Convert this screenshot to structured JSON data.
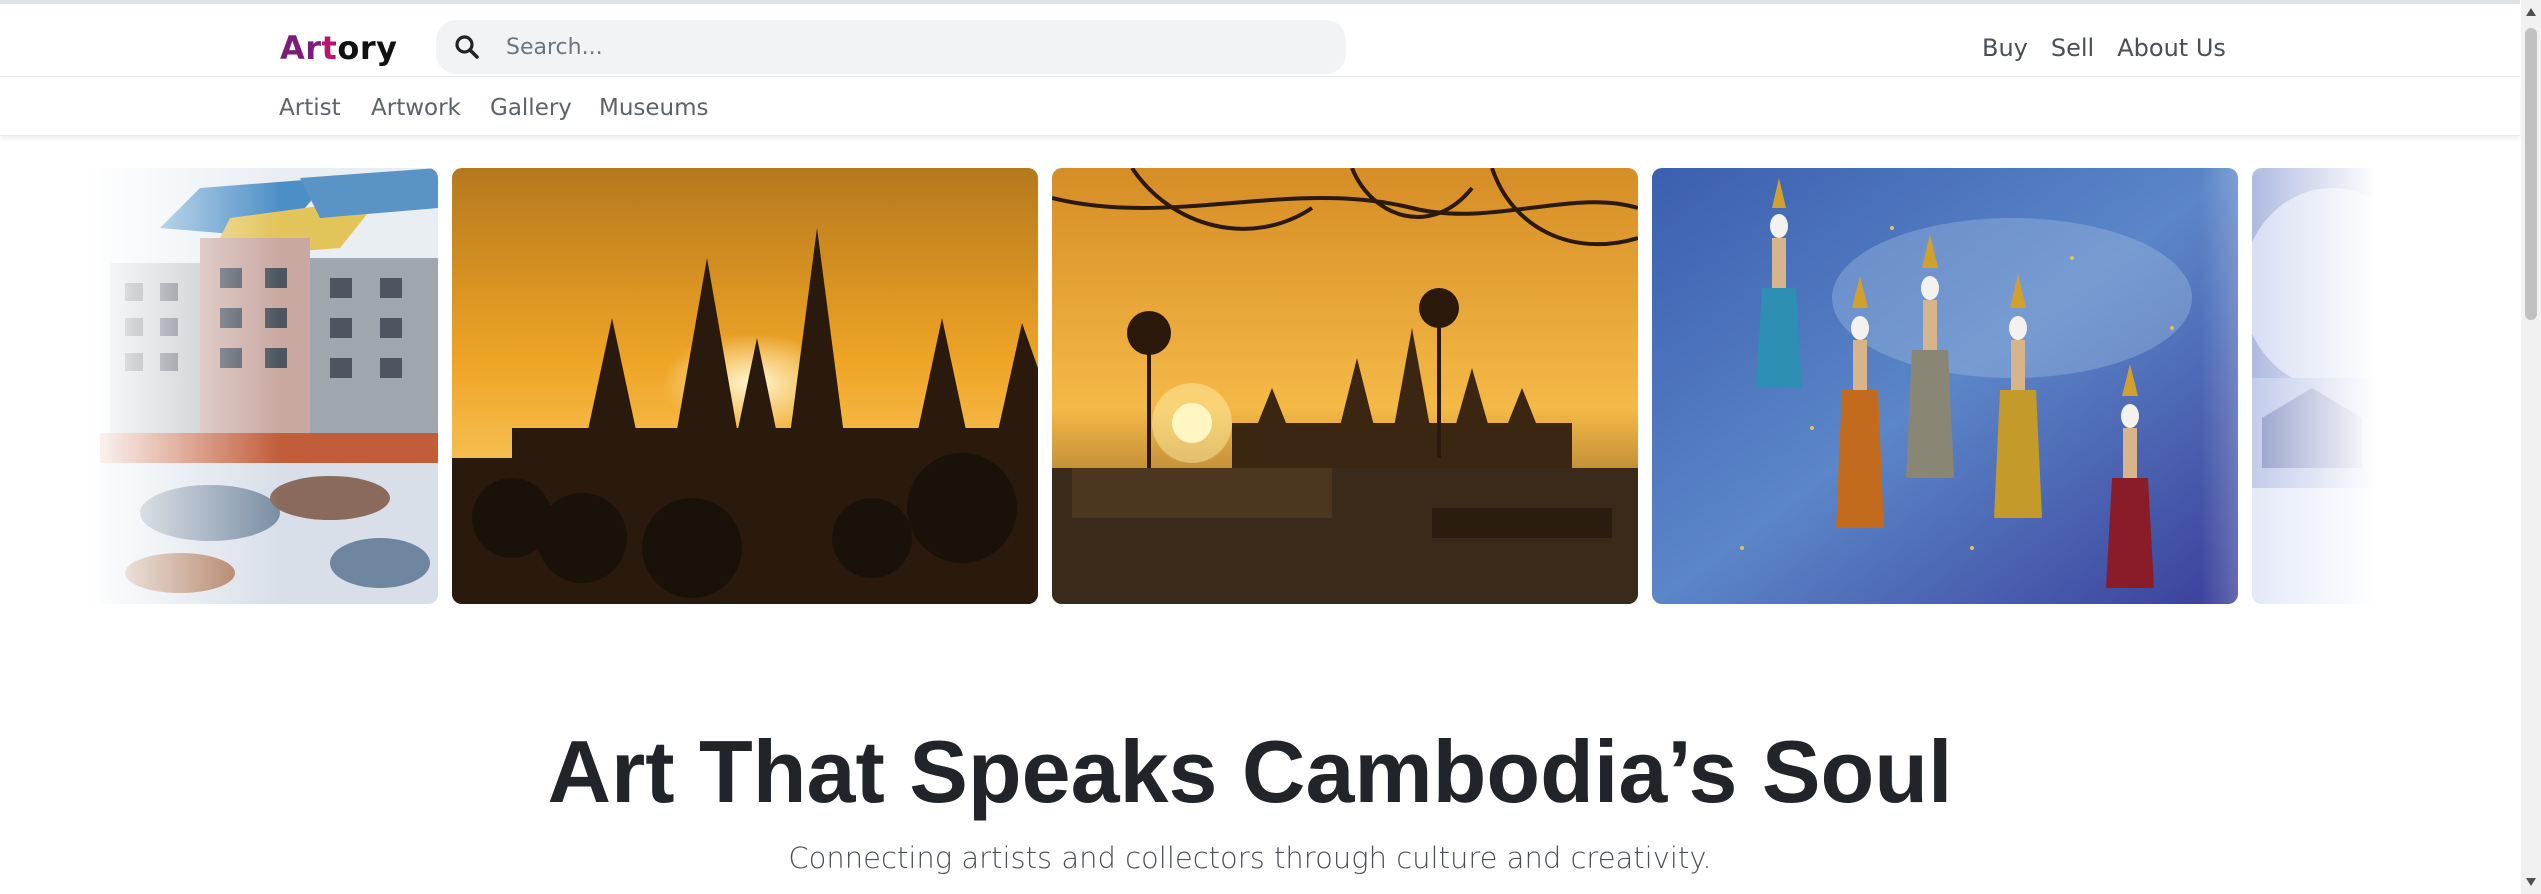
{
  "brand": {
    "logo_part1": "Ar",
    "logo_part2": "t",
    "logo_part3": "ory",
    "colors": {
      "ar": "#7b1e7a",
      "t": "#b9156c",
      "ory": "#111111"
    }
  },
  "search": {
    "placeholder": "Search...",
    "icon": "search-icon"
  },
  "nav": {
    "buy": "Buy",
    "sell": "Sell",
    "about": "About Us"
  },
  "subnav": {
    "items": [
      "Artist",
      "Artwork",
      "Gallery",
      "Museums"
    ]
  },
  "carousel": {
    "slides": [
      {
        "name": "street-buildings-painting"
      },
      {
        "name": "angkor-wat-sunset-photo"
      },
      {
        "name": "angkor-wat-sunrise-tree-photo"
      },
      {
        "name": "apsara-dancers-painting"
      },
      {
        "name": "winter-landscape-painting"
      }
    ]
  },
  "hero": {
    "title": "Art That Speaks Cambodia’s Soul",
    "subtitle": "Connecting artists and collectors through culture and creativity."
  }
}
